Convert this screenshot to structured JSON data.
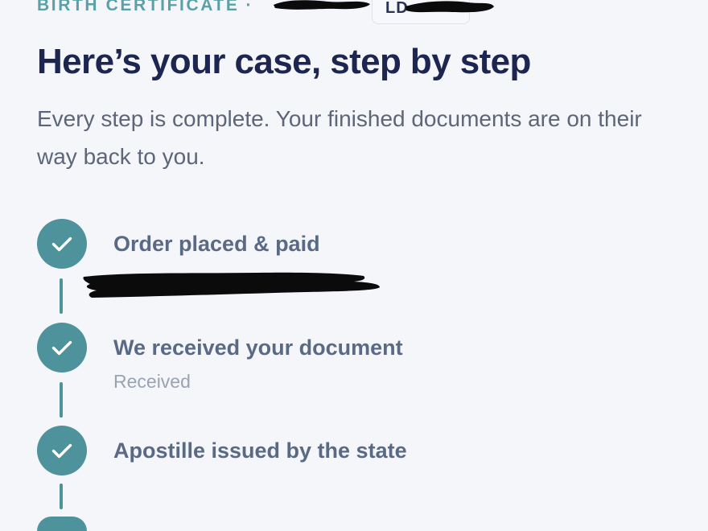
{
  "header": {
    "eyebrow": "BIRTH CERTIFICATE",
    "separator": "·",
    "case_id_prefix": "LD-"
  },
  "title": "Here’s your case, step by step",
  "subtitle": "Every step is complete. Your finished documents are on their way back to you.",
  "steps": [
    {
      "title": "Order placed & paid",
      "subtitle": "",
      "status": "complete",
      "icon": "check-icon"
    },
    {
      "title": "We received your document",
      "subtitle": "Received",
      "status": "complete",
      "icon": "check-icon"
    },
    {
      "title": "Apostille issued by the state",
      "subtitle": "",
      "status": "complete",
      "icon": "check-icon"
    }
  ],
  "colors": {
    "accent": "#4e929c",
    "eyebrow": "#5aa0a6",
    "title": "#1d2650",
    "body": "#5d6679",
    "step_title": "#5a6a84",
    "step_sub": "#9aa3b3",
    "background": "#f5f6fa"
  }
}
